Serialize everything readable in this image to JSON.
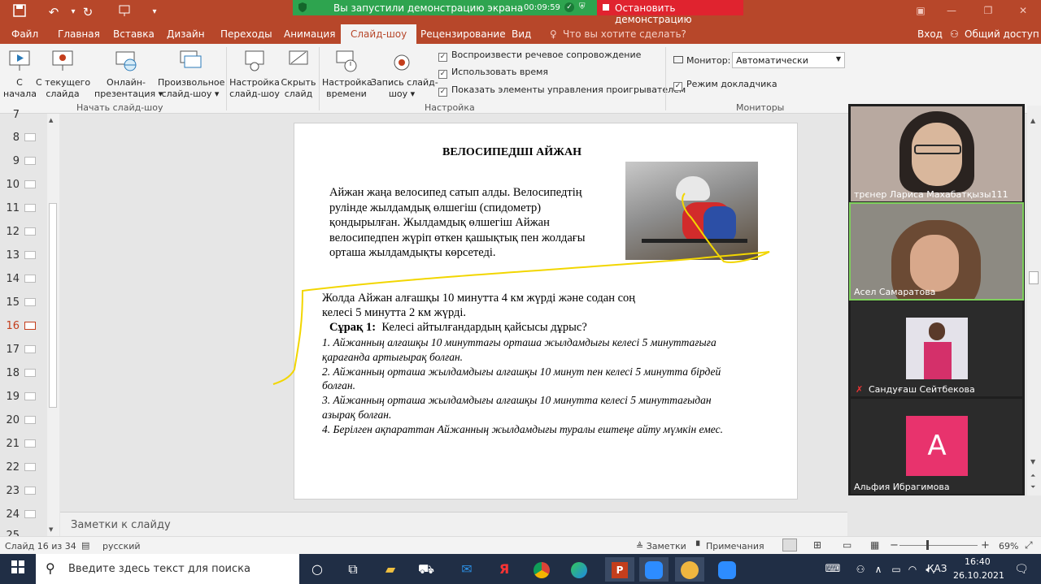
{
  "zoom_banner": {
    "status_text": "Вы запустили демонстрацию экрана",
    "timer": "00:09:59",
    "stop_label": "Остановить демонстрацию",
    "green": "#2ea44f",
    "red": "#e0232f"
  },
  "titlebar": {
    "color": "#b7472a"
  },
  "menu_tabs": [
    "Файл",
    "Главная",
    "Вставка",
    "Дизайн",
    "Переходы",
    "Анимация",
    "Слайд-шоу",
    "Рецензирование",
    "Вид"
  ],
  "active_tab": "Слайд-шоу",
  "tell_me": "Что вы хотите сделать?",
  "signin": "Вход",
  "share": "Общий доступ",
  "ribbon": {
    "from_start_l1": "С",
    "from_start_l2": "начала",
    "from_current_l1": "С текущего",
    "from_current_l2": "слайда",
    "online_l1": "Онлайн-",
    "online_l2": "презентация ▾",
    "custom_l1": "Произвольное",
    "custom_l2": "слайд-шоу ▾",
    "group_start": "Начать слайд-шоу",
    "setup_l1": "Настройка",
    "setup_l2": "слайд-шоу",
    "hide_l1": "Скрыть",
    "hide_l2": "слайд",
    "rehearse_l1": "Настройка",
    "rehearse_l2": "времени",
    "record_l1": "Запись слайд-",
    "record_l2": "шоу ▾",
    "opt_narration": "Воспроизвести речевое сопровождение",
    "opt_timings": "Использовать время",
    "opt_controls": "Показать элементы управления проигрывателем",
    "group_setup": "Настройка",
    "monitor_label": "Монитор:",
    "monitor_value": "Автоматически",
    "presenter_view": "Режим докладчика",
    "group_monitors": "Мониторы"
  },
  "thumbnails": [
    "7",
    "8",
    "9",
    "10",
    "11",
    "12",
    "13",
    "14",
    "15",
    "16",
    "17",
    "18",
    "19",
    "20",
    "21",
    "22",
    "23",
    "24",
    "25"
  ],
  "selected_slide": "16",
  "slide": {
    "title": "ВЕЛОСИПЕДШІ АЙЖАН",
    "intro_1": "Айжан жаңа велосипед сатып алды. Велосипедтің",
    "intro_2": "рулінде  жылдамдық  өлшегіш (спидометр)",
    "intro_3": "қондырылған. Жылдамдық өлшегіш Айжан",
    "intro_4": "велосипедпен жүріп өткен  қашықтық  пен  жолдағы",
    "intro_5": "орташа  жылдамдықты көрсетеді.",
    "cond_1": "Жолда Айжан алғашқы  10 минутта  4 км  жүрді  және содан соң",
    "cond_2": "келесі  5 минутта  2 км жүрді.",
    "q_label": "Сұрақ 1:",
    "q_text": "Келесі айтылғандардың қайсысы дұрыс?",
    "o1a": "1.  Айжанның алғашқы 10 минуттағы орташа жылдамдығы келесі 5 минуттағыға",
    "o1b": "қарағанда артығырақ болған.",
    "o2a": "2.  Айжанның орташа жылдамдығы алғашқы 10 минут пен келесі 5 минутта бірдей",
    "o2b": "болған.",
    "o3a": "3.  Айжанның орташа жылдамдығы алғашқы 10 минутта келесі 5 минуттағыдан",
    "o3b": "азырақ болған.",
    "o4": "4.  Берілген ақпараттан Айжанның жылдамдығы туралы ештеңе айту мүмкін емес."
  },
  "notes_placeholder": "Заметки к слайду",
  "status": {
    "slide_counter": "Слайд 16 из 34",
    "language": "русский",
    "notes_btn": "Заметки",
    "comments_btn": "Примечания",
    "zoom": "69%"
  },
  "participants": [
    {
      "name": "трєнер Лариса Махабатқызы111",
      "kind": "video"
    },
    {
      "name": "Асел Самаратова",
      "kind": "video",
      "highlighted": true
    },
    {
      "name": "Сандуғаш Сейтбекова",
      "kind": "photo",
      "muted": true
    },
    {
      "name": "Альфия Ибрагимова",
      "kind": "avatar",
      "initial": "А",
      "color": "#e8336d"
    }
  ],
  "taskbar": {
    "search_placeholder": "Введите здесь текст для поиска",
    "language": "ҚАЗ",
    "time": "16:40",
    "date": "26.10.2021"
  }
}
